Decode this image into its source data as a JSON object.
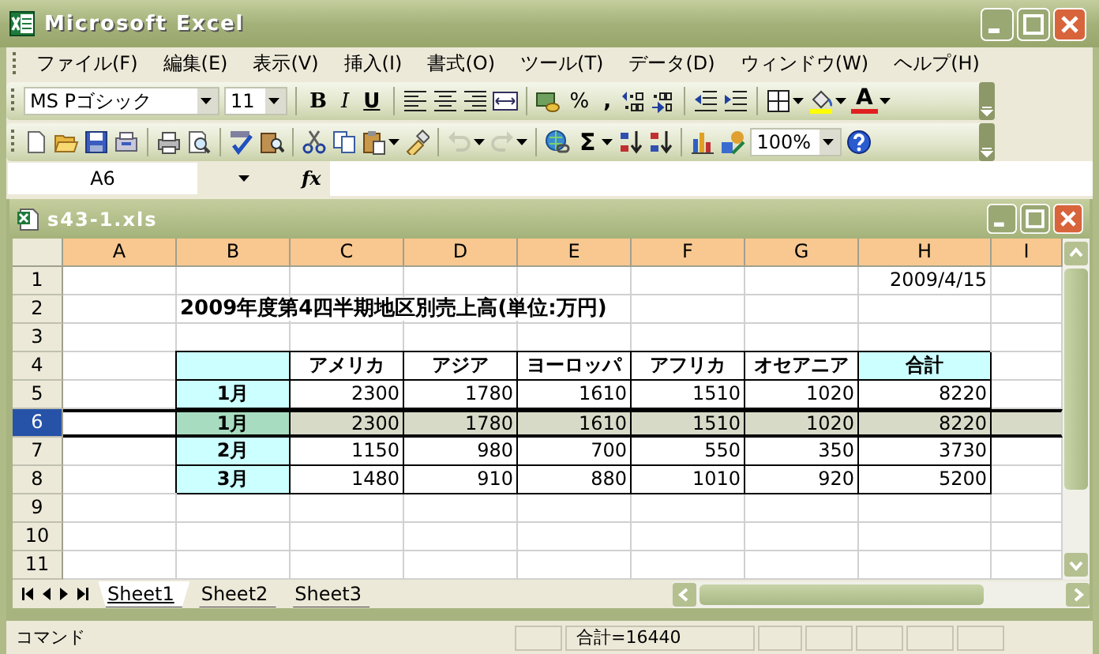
{
  "window": {
    "title": "Microsoft Excel"
  },
  "menu": [
    "ファイル(F)",
    "編集(E)",
    "表示(V)",
    "挿入(I)",
    "書式(O)",
    "ツール(T)",
    "データ(D)",
    "ウィンドウ(W)",
    "ヘルプ(H)"
  ],
  "formatting_toolbar": {
    "font": "MS Pゴシック",
    "size": "11",
    "bold": "B",
    "italic": "I",
    "underline": "U",
    "percent": "%",
    "comma": ",",
    "font_color": "A"
  },
  "standard_toolbar": {
    "sum": "Σ",
    "zoom": "100%",
    "undo": {
      "disabled": true
    },
    "redo": {
      "disabled": true
    }
  },
  "formula_bar": {
    "name_box": "A6",
    "fx": "fx"
  },
  "workbook": {
    "title": "s43-1.xls",
    "columns": [
      "A",
      "B",
      "C",
      "D",
      "E",
      "F",
      "G",
      "H",
      "I"
    ],
    "rows": [
      {
        "number": "1",
        "selected": false,
        "cells": [
          {
            "kind": "empty"
          },
          {
            "kind": "empty"
          },
          {
            "kind": "empty"
          },
          {
            "kind": "empty"
          },
          {
            "kind": "empty"
          },
          {
            "kind": "empty"
          },
          {
            "kind": "empty"
          },
          {
            "kind": "date",
            "text": "2009/4/15"
          }
        ]
      },
      {
        "number": "2",
        "selected": false,
        "cells": [
          {
            "kind": "empty"
          },
          {
            "kind": "title",
            "text": "2009年度第4四半期地区別売上高(単位:万円)"
          },
          {
            "kind": "empty"
          },
          {
            "kind": "empty"
          },
          {
            "kind": "empty"
          },
          {
            "kind": "empty"
          },
          {
            "kind": "empty"
          },
          {
            "kind": "empty"
          }
        ]
      },
      {
        "number": "3",
        "selected": false,
        "cells": [
          {
            "kind": "empty"
          },
          {
            "kind": "empty"
          },
          {
            "kind": "empty"
          },
          {
            "kind": "empty"
          },
          {
            "kind": "empty"
          },
          {
            "kind": "empty"
          },
          {
            "kind": "empty"
          },
          {
            "kind": "empty"
          }
        ]
      },
      {
        "number": "4",
        "selected": false,
        "cells": [
          {
            "kind": "empty"
          },
          {
            "kind": "corner",
            "highlighted": true
          },
          {
            "kind": "header",
            "text": "アメリカ",
            "highlighted": false
          },
          {
            "kind": "header",
            "text": "アジア",
            "highlighted": false
          },
          {
            "kind": "header",
            "text": "ヨーロッパ",
            "highlighted": false
          },
          {
            "kind": "header",
            "text": "アフリカ",
            "highlighted": false
          },
          {
            "kind": "header",
            "text": "オセアニア",
            "highlighted": false
          },
          {
            "kind": "header",
            "text": "合計",
            "highlighted": true
          }
        ]
      },
      {
        "number": "5",
        "selected": false,
        "cells": [
          {
            "kind": "empty"
          },
          {
            "kind": "label",
            "text": "1月",
            "highlighted": true
          },
          {
            "kind": "number",
            "text": "2300"
          },
          {
            "kind": "number",
            "text": "1780"
          },
          {
            "kind": "number",
            "text": "1610"
          },
          {
            "kind": "number",
            "text": "1510"
          },
          {
            "kind": "number",
            "text": "1020"
          },
          {
            "kind": "number",
            "text": "8220"
          }
        ]
      },
      {
        "number": "6",
        "selected": true,
        "cells": [
          {
            "kind": "empty"
          },
          {
            "kind": "label",
            "text": "1月",
            "highlighted": true
          },
          {
            "kind": "number",
            "text": "2300"
          },
          {
            "kind": "number",
            "text": "1780"
          },
          {
            "kind": "number",
            "text": "1610"
          },
          {
            "kind": "number",
            "text": "1510"
          },
          {
            "kind": "number",
            "text": "1020"
          },
          {
            "kind": "number",
            "text": "8220"
          }
        ]
      },
      {
        "number": "7",
        "selected": false,
        "cells": [
          {
            "kind": "empty"
          },
          {
            "kind": "label",
            "text": "2月",
            "highlighted": true
          },
          {
            "kind": "number",
            "text": "1150"
          },
          {
            "kind": "number",
            "text": "980"
          },
          {
            "kind": "number",
            "text": "700"
          },
          {
            "kind": "number",
            "text": "550"
          },
          {
            "kind": "number",
            "text": "350"
          },
          {
            "kind": "number",
            "text": "3730"
          }
        ]
      },
      {
        "number": "8",
        "selected": false,
        "cells": [
          {
            "kind": "empty"
          },
          {
            "kind": "label",
            "text": "3月",
            "highlighted": true
          },
          {
            "kind": "number",
            "text": "1480"
          },
          {
            "kind": "number",
            "text": "910"
          },
          {
            "kind": "number",
            "text": "880"
          },
          {
            "kind": "number",
            "text": "1010"
          },
          {
            "kind": "number",
            "text": "920"
          },
          {
            "kind": "number",
            "text": "5200"
          }
        ]
      },
      {
        "number": "9",
        "selected": false,
        "cells": [
          {
            "kind": "empty"
          },
          {
            "kind": "empty"
          },
          {
            "kind": "empty"
          },
          {
            "kind": "empty"
          },
          {
            "kind": "empty"
          },
          {
            "kind": "empty"
          },
          {
            "kind": "empty"
          },
          {
            "kind": "empty"
          }
        ]
      },
      {
        "number": "10",
        "selected": false,
        "cells": [
          {
            "kind": "empty"
          },
          {
            "kind": "empty"
          },
          {
            "kind": "empty"
          },
          {
            "kind": "empty"
          },
          {
            "kind": "empty"
          },
          {
            "kind": "empty"
          },
          {
            "kind": "empty"
          },
          {
            "kind": "empty"
          }
        ]
      },
      {
        "number": "11",
        "selected": false,
        "cells": [
          {
            "kind": "empty"
          },
          {
            "kind": "empty"
          },
          {
            "kind": "empty"
          },
          {
            "kind": "empty"
          },
          {
            "kind": "empty"
          },
          {
            "kind": "empty"
          },
          {
            "kind": "empty"
          },
          {
            "kind": "empty"
          }
        ]
      }
    ]
  },
  "sheet_tabs": [
    {
      "label": "Sheet1",
      "selected": true
    },
    {
      "label": "Sheet2",
      "selected": false
    },
    {
      "label": "Sheet3",
      "selected": false
    }
  ],
  "status_bar": {
    "mode": "コマンド",
    "sum": "合計=16440"
  }
}
